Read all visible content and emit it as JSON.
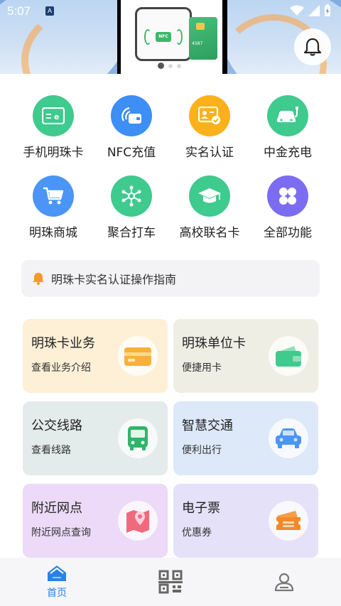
{
  "status": {
    "time": "5:07",
    "a_badge": "A"
  },
  "banner": {
    "nfc_label": "NFC",
    "card_number": "4587",
    "dots": 3,
    "active_dot": 0
  },
  "features": [
    {
      "label": "手机明珠卡",
      "icon": "card-e-icon",
      "color": "#3fca8e"
    },
    {
      "label": "NFC充值",
      "icon": "nfc-wallet-icon",
      "color": "#3d8ef5"
    },
    {
      "label": "实名认证",
      "icon": "id-verify-icon",
      "color": "#fbb11a"
    },
    {
      "label": "中金充电",
      "icon": "ev-charge-icon",
      "color": "#3fca8e"
    },
    {
      "label": "明珠商城",
      "icon": "shopping-cart-icon",
      "color": "#4a95f5"
    },
    {
      "label": "聚合打车",
      "icon": "network-icon",
      "color": "#3fca8e"
    },
    {
      "label": "高校联名卡",
      "icon": "graduation-cap-icon",
      "color": "#3fca8e"
    },
    {
      "label": "全部功能",
      "icon": "all-functions-icon",
      "color": "#7c6cf2"
    }
  ],
  "notice": {
    "text": "明珠卡实名认证操作指南"
  },
  "cards": [
    {
      "title": "明珠卡业务",
      "subtitle": "查看业务介绍",
      "bg": "#fdf0d6",
      "icon": "card-icon"
    },
    {
      "title": "明珠单位卡",
      "subtitle": "便捷用卡",
      "bg": "#eeeee4",
      "icon": "wallet-icon"
    },
    {
      "title": "公交线路",
      "subtitle": "查看线路",
      "bg": "#e3ecea",
      "icon": "bus-icon"
    },
    {
      "title": "智慧交通",
      "subtitle": "便利出行",
      "bg": "#dde8f8",
      "icon": "car-icon"
    },
    {
      "title": "附近网点",
      "subtitle": "附近网点查询",
      "bg": "#ecdaf8",
      "icon": "map-pin-icon"
    },
    {
      "title": "电子票",
      "subtitle": "优惠券",
      "bg": "#e4e1f8",
      "icon": "ticket-icon"
    }
  ],
  "nav": [
    {
      "label": "首页",
      "icon": "home-icon",
      "active": true
    },
    {
      "label": "",
      "icon": "qrcode-icon",
      "active": false
    },
    {
      "label": "",
      "icon": "profile-icon",
      "active": false
    }
  ]
}
